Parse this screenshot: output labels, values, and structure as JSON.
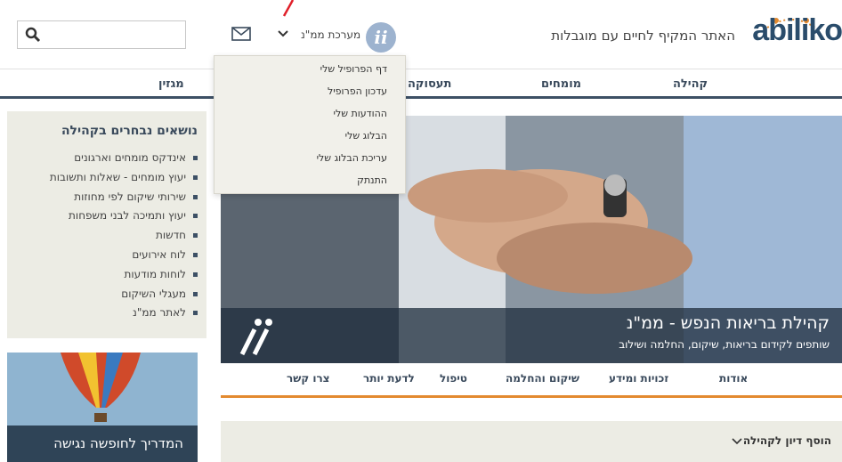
{
  "header": {
    "logo_text": "abiliko",
    "tagline": "האתר המקיף לחיים עם מוגבלות",
    "user_name": "מערכת ממ\"נ",
    "avatar_letters": "ii"
  },
  "nav": {
    "items": [
      "קהילה",
      "מומחים",
      "תעסוקה",
      "מגזין"
    ]
  },
  "dropdown": {
    "items": [
      "דף הפרופיל שלי",
      "עדכון הפרופיל",
      "ההודעות שלי",
      "הבלוג שלי",
      "עריכת הבלוג שלי",
      "התנתק"
    ]
  },
  "hero": {
    "title": "קהילת בריאות הנפש - ממ\"נ",
    "subtitle": "שותפים לקידום בריאות, שיקום, החלמה ושילוב",
    "logo_letters": "ii"
  },
  "subnav": {
    "items": [
      "אודות",
      "זכויות ומידע",
      "שיקום והחלמה",
      "טיפול",
      "לדעת יותר",
      "צרו קשר"
    ]
  },
  "add_discussion": {
    "label": "הוסף דיון לקהילה"
  },
  "sidebar": {
    "title": "נושאים נבחרים בקהילה",
    "items": [
      "אינדקס מומחים וארגונים",
      "יעוץ מומחים - שאלות ותשובות",
      "שירותי שיקום לפי מחוזות",
      "יעוץ ותמיכה לבני משפחות",
      "חדשות",
      "לוח אירועים",
      "לוחות מודעות",
      "מעגלי השיקום",
      "לאתר ממ\"נ"
    ]
  },
  "promo": {
    "label": "המדריך לחופשה נגישה"
  },
  "colors": {
    "accent": "#e38a2f",
    "navy": "#3d5065",
    "panel": "#ecece4",
    "annotation": "#e0202a"
  }
}
